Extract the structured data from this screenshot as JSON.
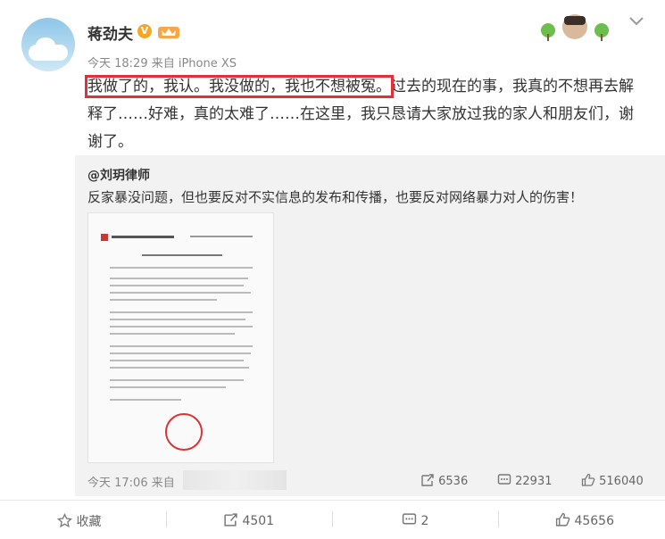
{
  "post": {
    "username": "蒋劲夫",
    "verify_badge": "V",
    "meta": "今天 18:29 来自 iPhone XS",
    "highlighted_text": "我做了的，我认。我没做的，我也不想被冤。",
    "rest_text": "过去的现在的事，我真的不想再去解释了……好难，真的太难了……在这里，我只恳请大家放过我的家人和朋友们，谢谢了。"
  },
  "repost": {
    "author": "@刘玥律师",
    "text": "反家暴没问题，但也要反对不实信息的发布和传播，也要反对网络暴力对人的伤害！",
    "meta": "今天 17:06 来自",
    "shares": "6536",
    "comments": "22931",
    "likes": "516040"
  },
  "actions": {
    "favorite": "收藏",
    "share": "4501",
    "comment": "2",
    "like": "45656"
  },
  "colors": {
    "highlight_box": "#e0303a",
    "verify": "#f5a623"
  }
}
